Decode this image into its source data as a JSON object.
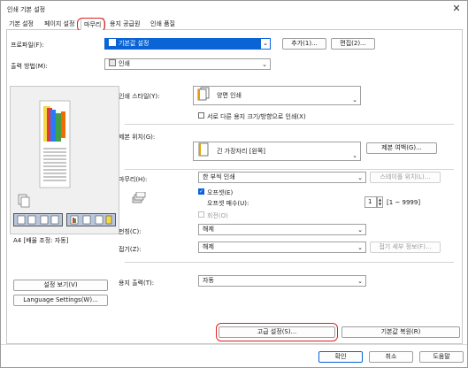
{
  "window": {
    "title": "인쇄 기본 설정",
    "close_glyph": "✕"
  },
  "tabs": [
    "기본 설정",
    "페이지 설정",
    "마무리",
    "용지 공급원",
    "인쇄 품질"
  ],
  "profile": {
    "label": "프로파일(F):",
    "value": "기본값 설정",
    "add_label": "추가(1)...",
    "edit_label": "편집(2)..."
  },
  "output_method": {
    "label": "출력 방법(M):",
    "value": "인쇄"
  },
  "preview": {
    "caption": "A4 [배율 조정: 자동]",
    "settings_view_label": "설정 보기(V)",
    "language_label": "Language Settings(W)..."
  },
  "print_style": {
    "label": "인쇄 스타일(Y):",
    "value": "양면 인쇄",
    "mixed_sizes_label": "서로 다른 용지 크기/방향으로 인쇄(X)",
    "mixed_sizes_checked": false
  },
  "binding": {
    "label": "제본 위치(G):",
    "value": "긴 가장자리 [왼쪽]",
    "margin_label": "제본 여백(G)..."
  },
  "finishing": {
    "label": "마무리(H):",
    "value": "한 부씩 인쇄",
    "staple_pos_label": "스테이플 위치(L)...",
    "offset_label": "오프셋(E)",
    "offset_checked": true,
    "offset_count_label": "오프셋 매수(U):",
    "offset_count_value": "1",
    "offset_range": "[1 ~ 9999]",
    "rotate_label": "회전(O)",
    "rotate_checked": false
  },
  "punch": {
    "label": "펀칭(C):",
    "value": "해제"
  },
  "fold": {
    "label": "접기(Z):",
    "value": "해제",
    "detail_label": "접기 세부 정보(F)..."
  },
  "paper_output": {
    "label": "용지 출력(T):",
    "value": "자동"
  },
  "advanced": {
    "label": "고급 설정(S)...",
    "restore_label": "기본값 복원(R)"
  },
  "footer": {
    "ok": "확인",
    "cancel": "취소",
    "help": "도움말"
  },
  "colors": {
    "accent": "#0a64d6",
    "highlight": "#e02020"
  }
}
